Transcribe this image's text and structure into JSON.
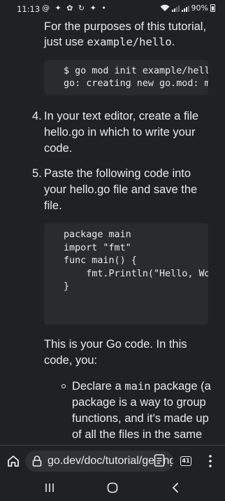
{
  "status_bar": {
    "time": "11:13",
    "notification_icons": "@ ✦ ✿ ↻ ✦ •",
    "battery_text": "90%"
  },
  "article": {
    "intro_line1": "For the purposes of this tutorial,",
    "intro_line2_pre": "just use ",
    "intro_line2_code": "example/hello",
    "intro_line2_post": ".",
    "code1": [
      "$ go mod init example/hello",
      "go: creating new go.mod: module example/hello"
    ],
    "step4_num": "4.",
    "step4_lines": [
      "In your text editor, create a file",
      "hello.go in which to write your",
      "code."
    ],
    "step5_num": "5.",
    "step5_lines": [
      "Paste the following code into",
      "your hello.go file and save the",
      "file."
    ],
    "code2": [
      "package main",
      "",
      "import \"fmt\"",
      "",
      "func main() {",
      "    fmt.Println(\"Hello, World!\")",
      "}"
    ],
    "summary_lines": [
      "This is your Go code. In this",
      "code, you:"
    ],
    "bullet_line1_pre": "Declare a ",
    "bullet_line1_code": "main",
    "bullet_line1_post": " package (a",
    "bullet_lines": [
      "package is a way to group",
      "functions, and it's made up",
      "of all the files in the same"
    ]
  },
  "browser": {
    "url": "go.dev/doc/tutorial/getting-started",
    "tab_count": "41"
  },
  "colors": {
    "background": "#202124",
    "code_background": "#2a2b2e",
    "text": "#e8eaed",
    "url_pill": "#303134"
  }
}
